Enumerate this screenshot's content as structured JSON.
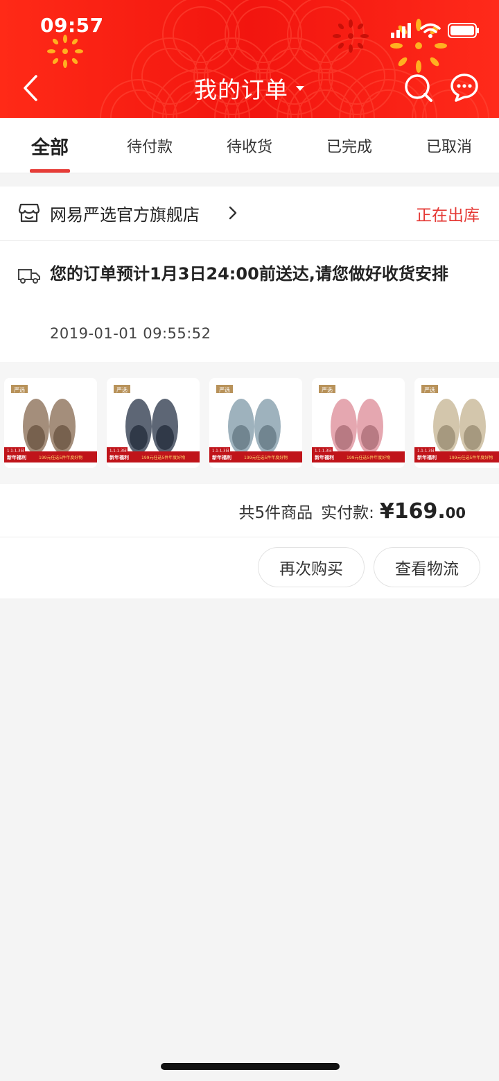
{
  "status_bar": {
    "time": "09:57"
  },
  "header": {
    "title": "我的订单",
    "background_color": "#f2150f",
    "icons": [
      "back-arrow-icon",
      "dropdown-caret-icon",
      "search-icon",
      "message-icon"
    ]
  },
  "tabs": [
    {
      "label": "全部",
      "active": true
    },
    {
      "label": "待付款",
      "active": false
    },
    {
      "label": "待收货",
      "active": false
    },
    {
      "label": "已完成",
      "active": false
    },
    {
      "label": "已取消",
      "active": false
    }
  ],
  "order": {
    "shop_name": "网易严选官方旗舰店",
    "status": "正在出库",
    "status_color": "#e53935",
    "delivery_message": "您的订单预计1月3日24:00前送达,请您做好收货安排",
    "delivery_time": "2019-01-01 09:55:52",
    "products": [
      {
        "name": "slipper-tan",
        "color": "#a48e7b",
        "badge": "严选",
        "promo_date": "1.1-1.3日",
        "promo_left": "新年福利",
        "promo_right": "199元任选5件年度好物"
      },
      {
        "name": "slipper-navy",
        "color": "#5d6675",
        "badge": "严选",
        "promo_date": "1.1-1.3日",
        "promo_left": "新年福利",
        "promo_right": "199元任选5件年度好物"
      },
      {
        "name": "slipper-lightblue",
        "color": "#9eb2bd",
        "badge": "严选",
        "promo_date": "1.1-1.3日",
        "promo_left": "新年福利",
        "promo_right": "199元任选5件年度好物"
      },
      {
        "name": "slipper-pink",
        "color": "#e5a7b0",
        "badge": "严选",
        "promo_date": "1.1-1.3日",
        "promo_left": "新年福利",
        "promo_right": "199元任选5件年度好物"
      },
      {
        "name": "slipper-beige",
        "color": "#d3c6ac",
        "badge": "严选",
        "promo_date": "1.1-1.3日",
        "promo_left": "新年福利",
        "promo_right": "199元任选5件年度好物"
      }
    ],
    "item_count_label": "共5件商品",
    "paid_label": "实付款:",
    "price_main": "¥169.",
    "price_cents": "00",
    "buttons": {
      "rebuy": "再次购买",
      "logistics": "查看物流"
    }
  }
}
